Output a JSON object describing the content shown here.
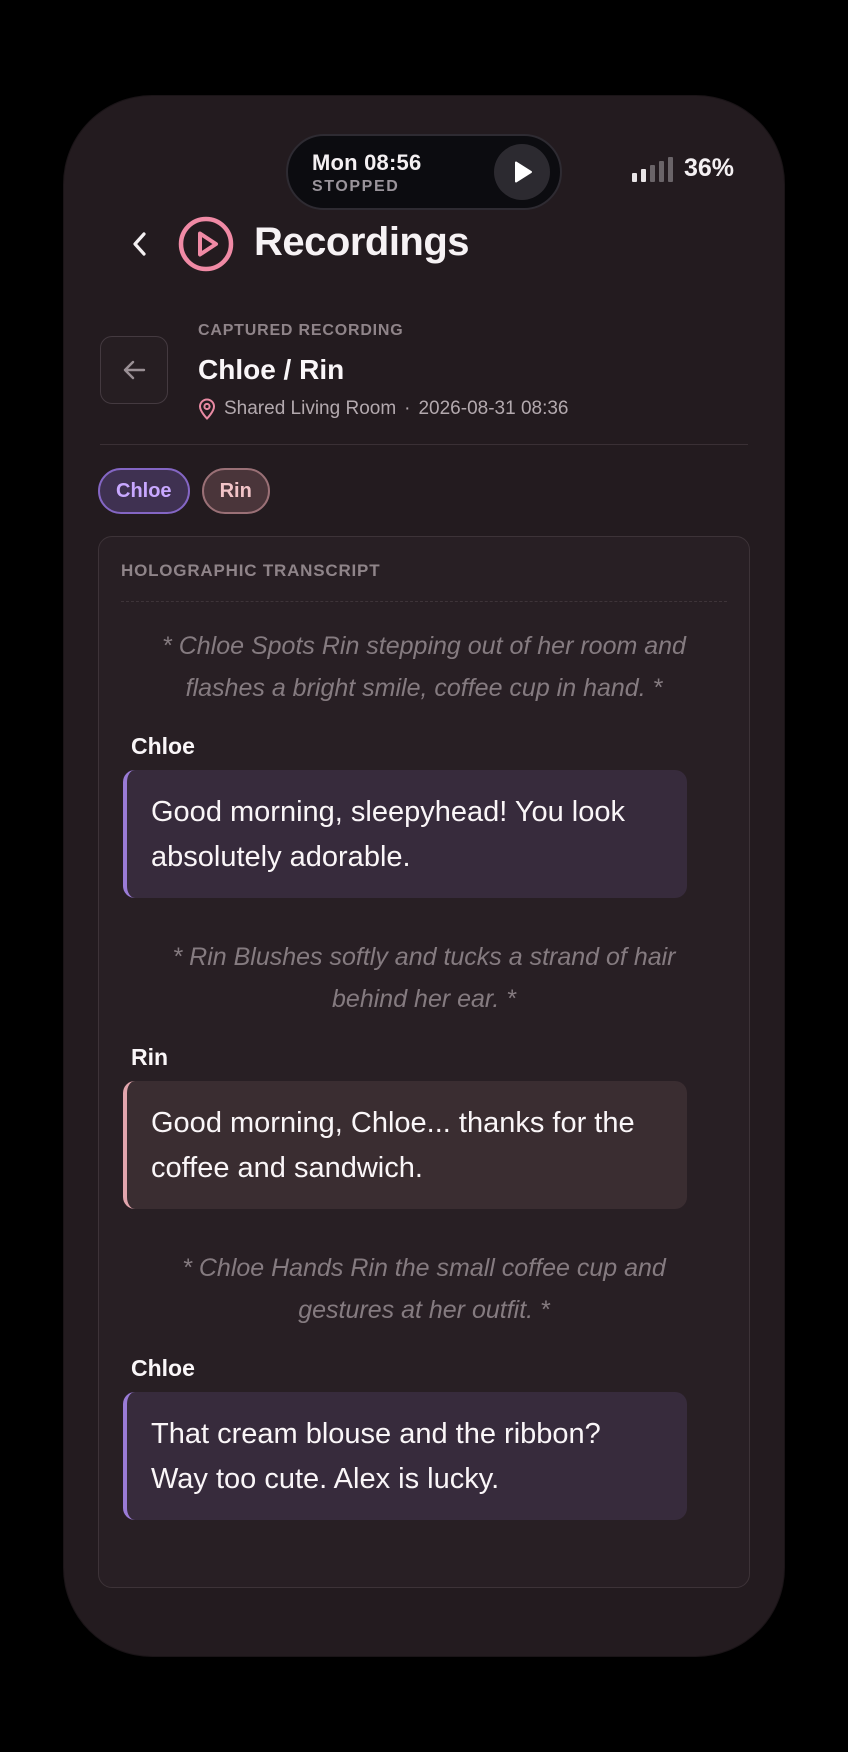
{
  "status_bar": {
    "time": "Mon 08:56",
    "playback_status": "STOPPED",
    "battery": "36%",
    "signal_bars": 5,
    "signal_active_bars": 2
  },
  "header": {
    "title": "Recordings",
    "icon": "play-circle-icon",
    "accent_color": "#f08aa5"
  },
  "recording": {
    "label": "CAPTURED RECORDING",
    "title": "Chloe / Rin",
    "location": "Shared Living Room",
    "separator": "·",
    "timestamp": "2026-08-31 08:36"
  },
  "participants": [
    {
      "name": "Chloe",
      "color": "#c8a8ff"
    },
    {
      "name": "Rin",
      "color": "#f2c4c8"
    }
  ],
  "transcript": {
    "label": "HOLOGRAPHIC TRANSCRIPT",
    "entries": [
      {
        "type": "action",
        "text": "* Chloe Spots Rin stepping out of her room and flashes a bright smile, coffee cup in hand. *"
      },
      {
        "type": "line",
        "speaker": "Chloe",
        "text": "Good morning, sleepyhead! You look absolutely adorable."
      },
      {
        "type": "action",
        "text": "* Rin Blushes softly and tucks a strand of hair behind her ear. *"
      },
      {
        "type": "line",
        "speaker": "Rin",
        "text": "Good morning, Chloe... thanks for the coffee and sandwich."
      },
      {
        "type": "action",
        "text": "* Chloe Hands Rin the small coffee cup and gestures at her outfit. *"
      },
      {
        "type": "line",
        "speaker": "Chloe",
        "text": "That cream blouse and the ribbon? Way too cute. Alex is lucky."
      }
    ]
  }
}
